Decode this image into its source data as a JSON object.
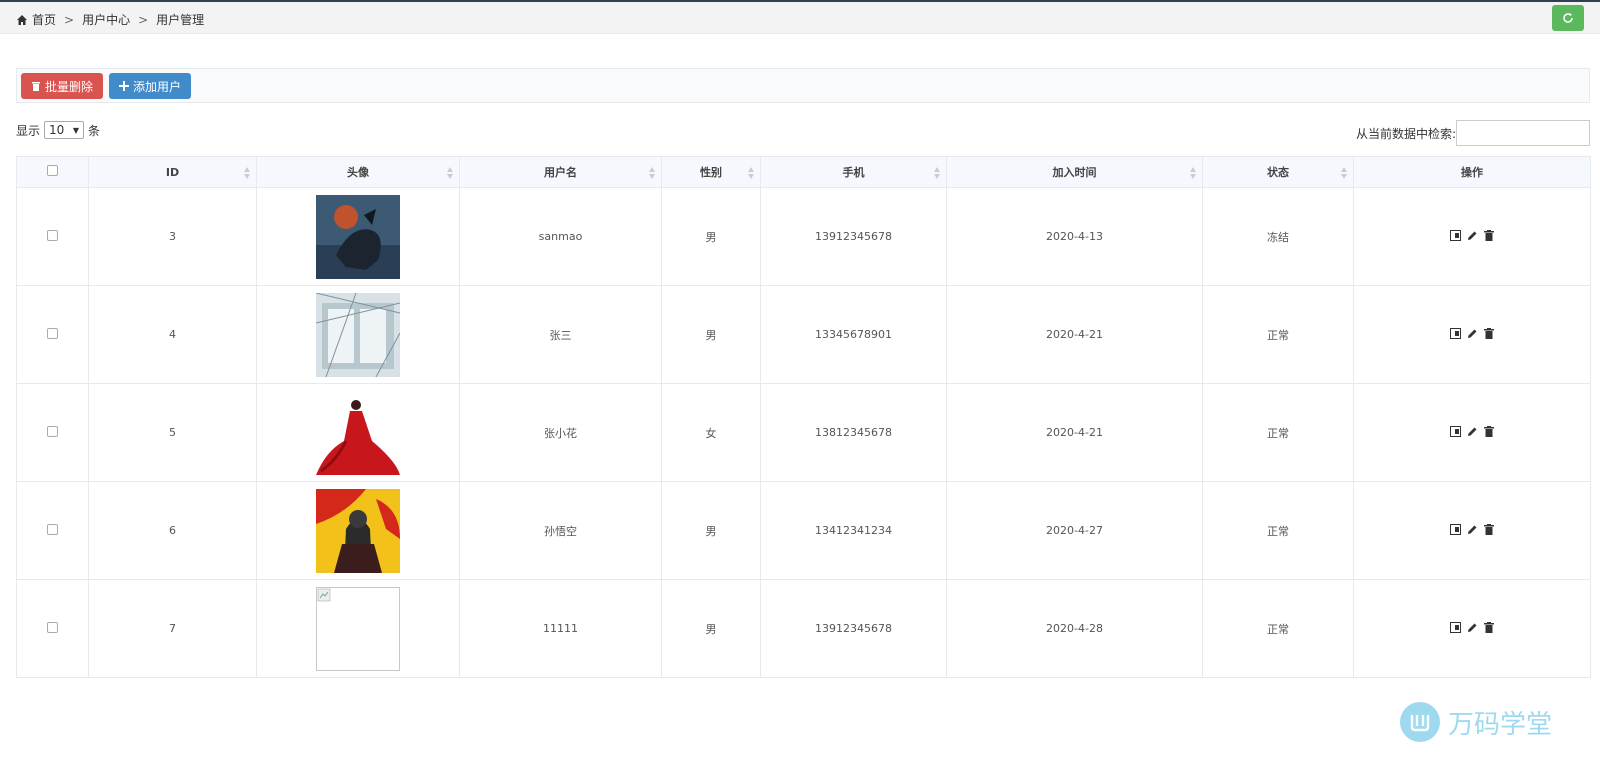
{
  "breadcrumb": {
    "items": [
      "首页",
      "用户中心",
      "用户管理"
    ],
    "separator": ">"
  },
  "toolbar": {
    "delete_label": "批量删除",
    "add_label": "添加用户"
  },
  "length": {
    "prefix": "显示",
    "value": "10",
    "suffix": "条"
  },
  "filter": {
    "label": "从当前数据中检索:",
    "value": ""
  },
  "table": {
    "headers": [
      "ID",
      "头像",
      "用户名",
      "性别",
      "手机",
      "加入时间",
      "状态",
      "操作"
    ],
    "rows": [
      {
        "id": "3",
        "username": "sanmao",
        "gender": "男",
        "phone": "13912345678",
        "joined": "2020-4-13",
        "status": "冻结",
        "avatar": "horse-rider"
      },
      {
        "id": "4",
        "username": "张三",
        "gender": "男",
        "phone": "13345678901",
        "joined": "2020-4-21",
        "status": "正常",
        "avatar": "snowy-window"
      },
      {
        "id": "5",
        "username": "张小花",
        "gender": "女",
        "phone": "13812345678",
        "joined": "2020-4-21",
        "status": "正常",
        "avatar": "red-dress"
      },
      {
        "id": "6",
        "username": "孙悟空",
        "gender": "男",
        "phone": "13412341234",
        "joined": "2020-4-27",
        "status": "正常",
        "avatar": "warrior"
      },
      {
        "id": "7",
        "username": "11111",
        "gender": "男",
        "phone": "13912345678",
        "joined": "2020-4-28",
        "status": "正常",
        "avatar": "broken-image"
      }
    ]
  },
  "watermark": {
    "text": "万码学堂"
  },
  "colors": {
    "danger": "#d9534f",
    "primary": "#428bca",
    "success": "#5cb85c"
  }
}
